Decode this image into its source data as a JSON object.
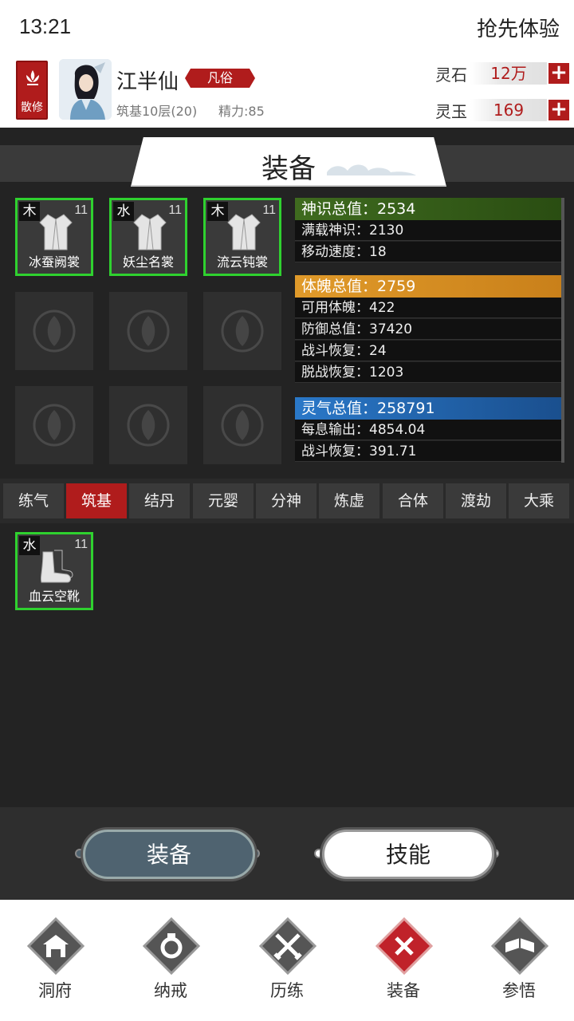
{
  "status_bar": {
    "time": "13:21",
    "right_text": "抢先体验"
  },
  "player": {
    "sect": "散修",
    "name": "江半仙",
    "rank": "凡俗",
    "realm": "筑基10层(20)",
    "energy": "精力:85"
  },
  "currencies": [
    {
      "label": "灵石",
      "value": "12万"
    },
    {
      "label": "灵玉",
      "value": "169"
    }
  ],
  "page_title": "装备",
  "equipped": [
    {
      "element": "木",
      "level": "11",
      "name": "冰蚕阙裳"
    },
    {
      "element": "水",
      "level": "11",
      "name": "妖尘名裳"
    },
    {
      "element": "木",
      "level": "11",
      "name": "流云钝裳"
    }
  ],
  "stats": {
    "shenshi_total": "神识总值：2534",
    "shenshi_rows": [
      "满载神识：2130",
      "移动速度：18"
    ],
    "tipo_total": "体魄总值：2759",
    "tipo_rows": [
      "可用体魄：422",
      "防御总值：37420",
      "战斗恢复：24",
      "脱战恢复：1203"
    ],
    "lingqi_total": "灵气总值：258791",
    "lingqi_rows": [
      "每息输出：4854.04",
      "战斗恢复：391.71"
    ],
    "colors": {
      "shenshi": "#3f6b1f",
      "tipo": "#d6891a",
      "lingqi": "#1e5fa8"
    }
  },
  "realm_tabs": [
    "练气",
    "筑基",
    "结丹",
    "元婴",
    "分神",
    "炼虚",
    "合体",
    "渡劫",
    "大乘"
  ],
  "active_tab": "筑基",
  "bag_items": [
    {
      "element": "水",
      "level": "11",
      "name": "血云空靴"
    }
  ],
  "actions": {
    "equip": "装备",
    "skills": "技能"
  },
  "bottom_nav": [
    {
      "label": "洞府",
      "icon": "cave-icon"
    },
    {
      "label": "纳戒",
      "icon": "ring-icon"
    },
    {
      "label": "历练",
      "icon": "swords-icon"
    },
    {
      "label": "装备",
      "icon": "equipment-icon"
    },
    {
      "label": "参悟",
      "icon": "book-icon"
    }
  ],
  "accent_color": "#b01c1c",
  "equip_border_color": "#2fd12f"
}
